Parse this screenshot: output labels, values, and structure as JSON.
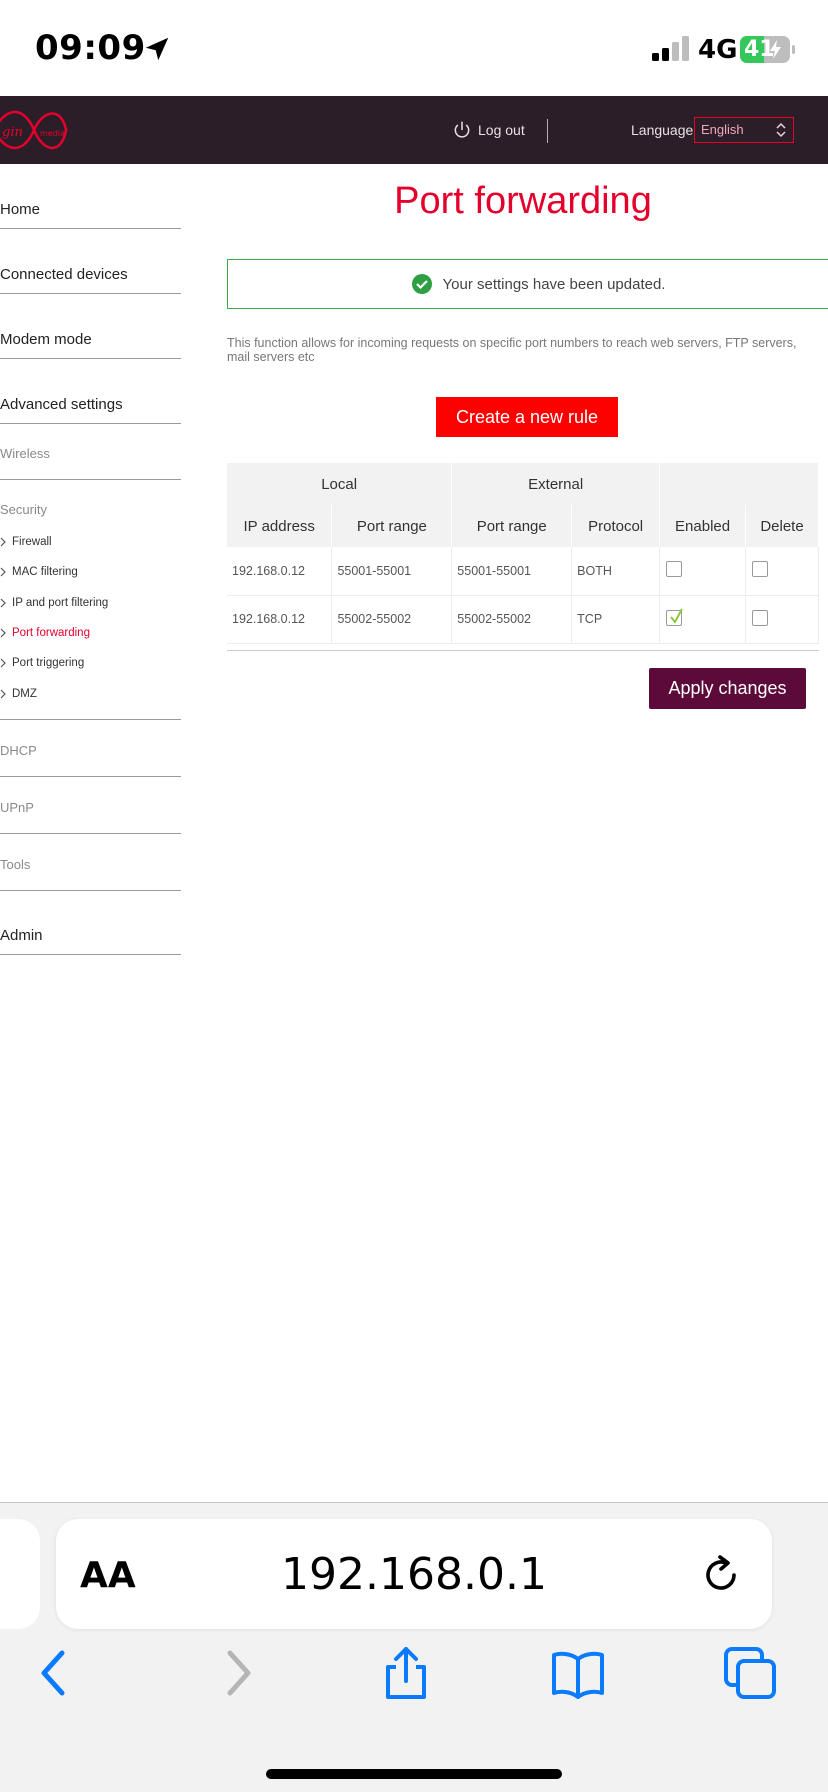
{
  "status_bar": {
    "time": "09:09",
    "network": "4G",
    "battery": "41"
  },
  "header": {
    "logo_text": "virgin media",
    "logout_label": "Log out",
    "language_label": "Language",
    "language_value": "English"
  },
  "sidebar": {
    "top_items": [
      {
        "label": "Home"
      },
      {
        "label": "Connected devices"
      },
      {
        "label": "Modem mode"
      },
      {
        "label": "Advanced settings"
      }
    ],
    "sections": [
      {
        "label": "Wireless"
      },
      {
        "label": "Security"
      },
      {
        "label": "DHCP"
      },
      {
        "label": "UPnP"
      },
      {
        "label": "Tools"
      }
    ],
    "security_items": [
      {
        "label": "Firewall"
      },
      {
        "label": "MAC filtering"
      },
      {
        "label": "IP and port filtering"
      },
      {
        "label": "Port forwarding"
      },
      {
        "label": "Port triggering"
      },
      {
        "label": "DMZ"
      }
    ],
    "admin_label": "Admin"
  },
  "main": {
    "title": "Port forwarding",
    "success_message": "Your settings have been updated.",
    "description": "This function allows for incoming requests on specific port numbers to reach web servers, FTP servers, mail servers etc",
    "create_button": "Create a new rule",
    "apply_button": "Apply changes",
    "table": {
      "group_headers": [
        "Local",
        "External"
      ],
      "columns": [
        "IP address",
        "Port range",
        "Port range",
        "Protocol",
        "Enabled",
        "Delete"
      ],
      "rows": [
        {
          "ip": "192.168.0.12",
          "local_port": "55001-55001",
          "external_port": "55001-55001",
          "protocol": "BOTH",
          "enabled": false,
          "delete": false
        },
        {
          "ip": "192.168.0.12",
          "local_port": "55002-55002",
          "external_port": "55002-55002",
          "protocol": "TCP",
          "enabled": true,
          "delete": false
        }
      ]
    }
  },
  "safari": {
    "text_size_label": "AA",
    "url": "192.168.0.1"
  },
  "colors": {
    "brand_red": "#e4002b",
    "header_bg": "#2b1e29",
    "apply_bg": "#5c0a3a",
    "success_green": "#3caa4a",
    "ios_blue": "#0a7aff"
  }
}
